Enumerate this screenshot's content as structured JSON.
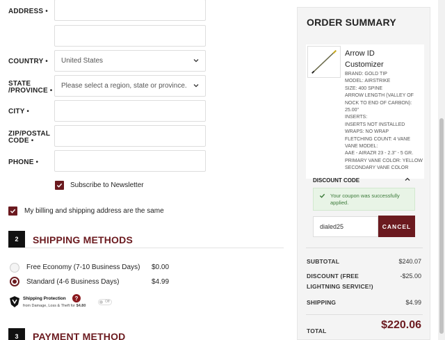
{
  "form": {
    "address_label": "ADDRESS",
    "country_label": "COUNTRY",
    "country_value": "United States",
    "state_label_1": "STATE",
    "state_label_2": "/PROVINCE",
    "state_placeholder": "Please select a region, state or province.",
    "city_label": "CITY",
    "zip_label_1": "ZIP/POSTAL",
    "zip_label_2": "CODE",
    "phone_label": "PHONE",
    "required_mark": "•",
    "newsletter_label": "Subscribe to Newsletter",
    "same_address_label": "My billing and shipping address are the same"
  },
  "shipping": {
    "number": "2",
    "title": "SHIPPING METHODS",
    "options": [
      {
        "name": "Free Economy (7-10 Business Days)",
        "price": "$0.00",
        "selected": false
      },
      {
        "name": "Standard (4-6 Business Days)",
        "price": "$4.99",
        "selected": true
      }
    ],
    "protection_title": "Shipping Protection",
    "protection_sub": "from Damage, Loss & Theft for",
    "protection_price": "$4.80",
    "protection_toggle": "Off"
  },
  "payment": {
    "number": "3",
    "title": "PAYMENT METHOD"
  },
  "summary": {
    "title": "ORDER SUMMARY",
    "item_name_1": "Arrow ID",
    "item_name_2": "Customizer",
    "item_meta": [
      "BRAND: GOLD TIP",
      "MODEL: AIRSTRIKE",
      "SIZE: 400 SPINE",
      "ARROW LENGTH (VALLEY OF NOCK TO END OF CARBON): 25.00\"",
      "INSERTS:",
      "INSERTS NOT INSTALLED",
      "WRAPS: NO WRAP",
      "FLETCHING COUNT: 4 VANE",
      "VANE MODEL:",
      "AAE - AIRAZR 23 - 2.3\" - 5 GR.",
      "PRIMARY VANE COLOR: YELLOW",
      "SECONDARY VANE COLOR"
    ],
    "discount_label": "DISCOUNT CODE",
    "success_msg": "Your coupon was successfully applied.",
    "coupon_value": "dialed25",
    "cancel_label": "CANCEL",
    "subtotal_label": "SUBTOTAL",
    "subtotal_value": "$240.07",
    "discount_row_label_1": "DISCOUNT (FREE",
    "discount_row_label_2": "LIGHTNING SERVICE!)",
    "discount_value": "-$25.00",
    "shipping_label": "SHIPPING",
    "shipping_value": "$4.99",
    "total_label": "TOTAL",
    "total_value": "$220.06"
  },
  "colors": {
    "accent": "#6b1a1f",
    "success_bg": "#e8f4e6",
    "panel_bg": "#f4f4f4"
  }
}
